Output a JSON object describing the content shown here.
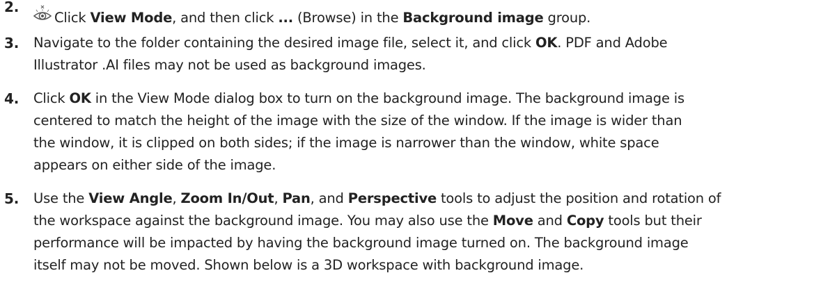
{
  "steps": [
    {
      "number": "2.",
      "icon": "view-mode-icon",
      "lines": [
        {
          "t1": "Click ",
          "b1": "View Mode",
          "t2": ", and then click ",
          "b2": "...",
          "t3": " (Browse) in the ",
          "b3": "Background image",
          "t4": " group."
        }
      ]
    },
    {
      "number": "3.",
      "lines": [
        {
          "t1": "Navigate to the folder containing the desired image file, select it, and click ",
          "b1": "OK",
          "t2": ". PDF and Adobe"
        },
        {
          "t1": "Illustrator .AI files may not be used as background images."
        }
      ]
    },
    {
      "number": "4.",
      "lines": [
        {
          "t1": "Click ",
          "b1": "OK",
          "t2": " in the View Mode dialog box to turn on the background image. The background image is"
        },
        {
          "t1": "centered to match the height of the image with the size of the window. If the image is wider than"
        },
        {
          "t1": "the window, it is clipped on both sides; if the image is narrower than the window, white space"
        },
        {
          "t1": "appears on either side of the image."
        }
      ]
    },
    {
      "number": "5.",
      "lines": [
        {
          "t1": "Use the ",
          "b1": "View Angle",
          "t2": ", ",
          "b2": "Zoom In/Out",
          "t3": ", ",
          "b3": "Pan",
          "t4": ", and ",
          "b4": "Perspective",
          "t5": " tools to adjust the position and rotation of"
        },
        {
          "t1": "the workspace against the background image. You may also use the ",
          "b1": "Move",
          "t2": " and ",
          "b2": "Copy",
          "t3": " tools but their"
        },
        {
          "t1": "performance will be impacted by having the background image turned on. The background image"
        },
        {
          "t1": "itself may not be moved. Shown below is a 3D workspace with background image."
        }
      ]
    }
  ]
}
